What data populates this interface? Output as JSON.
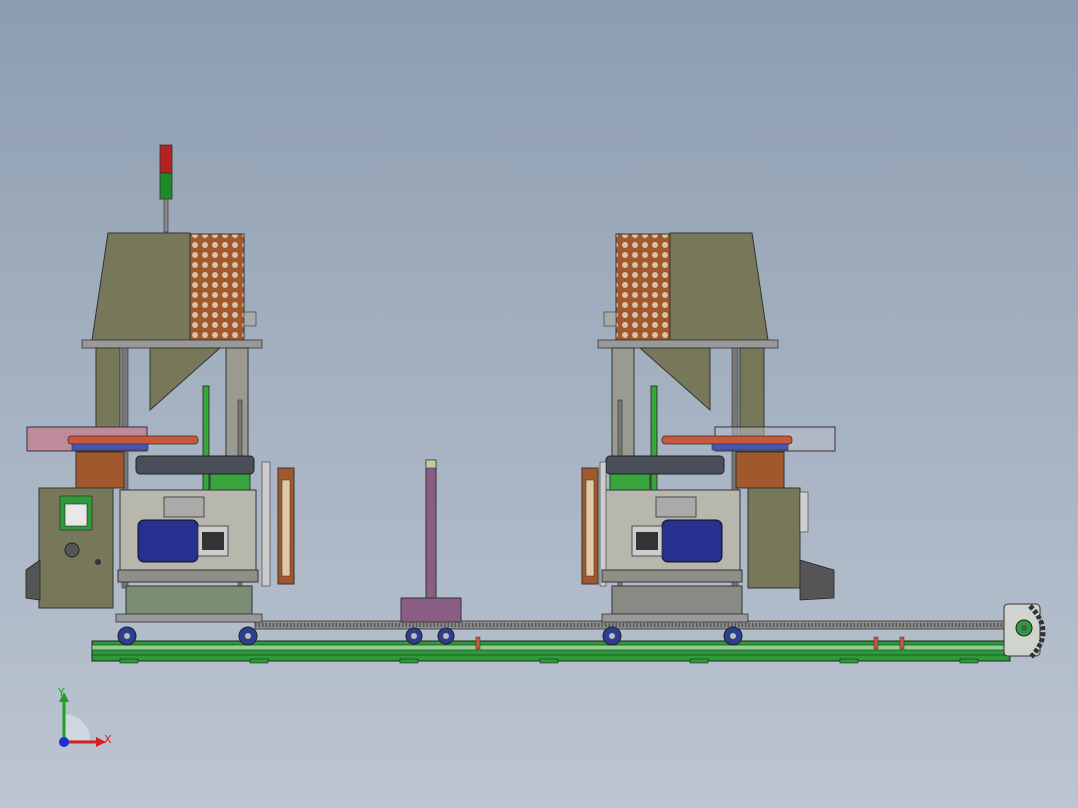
{
  "triad": {
    "x_label": "X",
    "y_label": "Y",
    "x_color": "#d42020",
    "y_color": "#1fa01f",
    "z_color": "#1b2fd0"
  },
  "colors": {
    "background_top": "#8d9db0",
    "background_bottom": "#bcc5d1",
    "olive_panel": "#77785a",
    "rust_panel": "#a0582c",
    "green_parts": "#38a63c",
    "motor_blue": "#27308f",
    "rail_green": "#2e9b3a",
    "purple_post": "#8a5d84",
    "signal_red": "#b52222",
    "signal_green": "#1f8a2a"
  },
  "parts": [
    "left-machine-head",
    "right-machine-head",
    "center-support-post",
    "base-rail",
    "lead-screw",
    "cable-chain",
    "signal-tower"
  ]
}
